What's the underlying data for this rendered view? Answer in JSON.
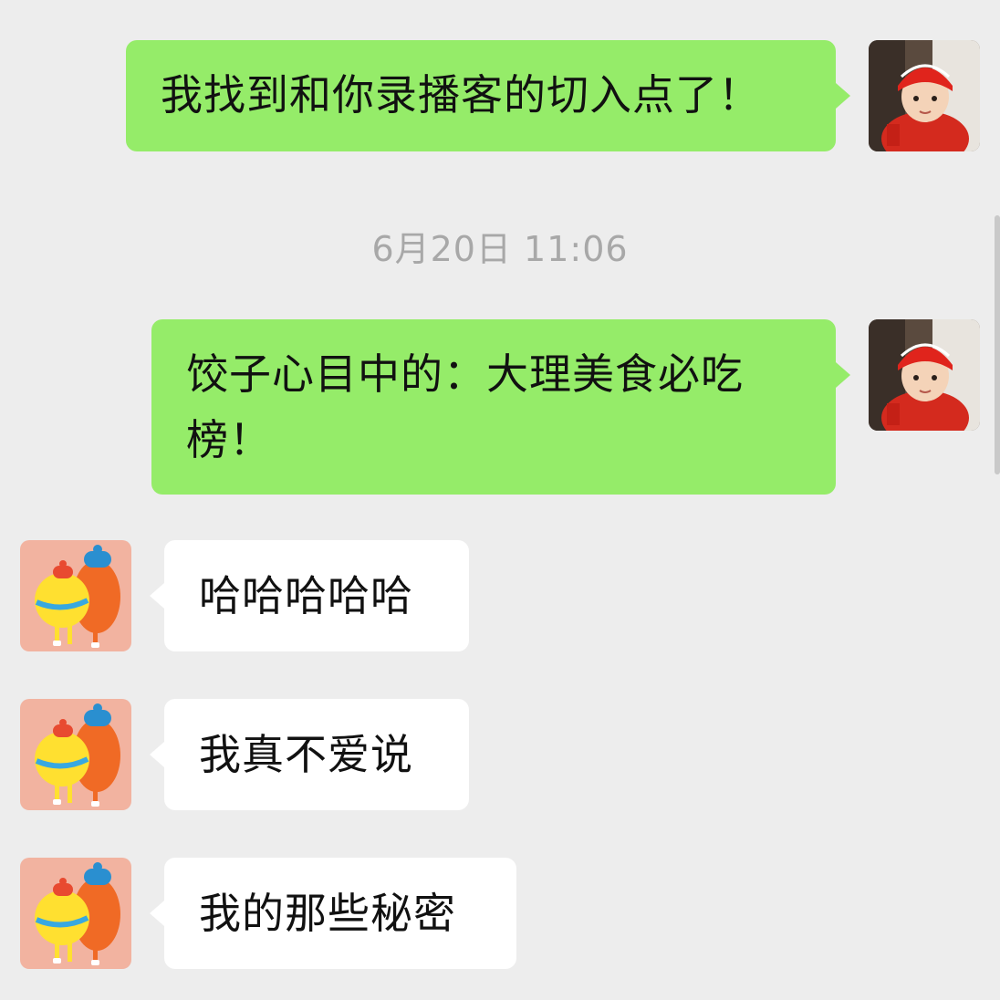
{
  "messages": [
    {
      "from": "me",
      "text": "我找到和你录播客的切入点了！"
    },
    {
      "timestamp": "6月20日 11:06"
    },
    {
      "from": "me",
      "text": "饺子心目中的：大理美食必吃榜！"
    },
    {
      "from": "friend",
      "text": "哈哈哈哈哈"
    },
    {
      "from": "friend",
      "text": "我真不爱说"
    },
    {
      "from": "friend",
      "text": "我的那些秘密"
    }
  ],
  "colors": {
    "background": "#ededed",
    "my_bubble": "#95ec69",
    "friend_bubble": "#ffffff",
    "timestamp_text": "#a8a8a8"
  },
  "icons": {
    "my_avatar": "girl-red-hat-avatar-icon",
    "friend_avatar": "hugging-characters-avatar-icon"
  }
}
